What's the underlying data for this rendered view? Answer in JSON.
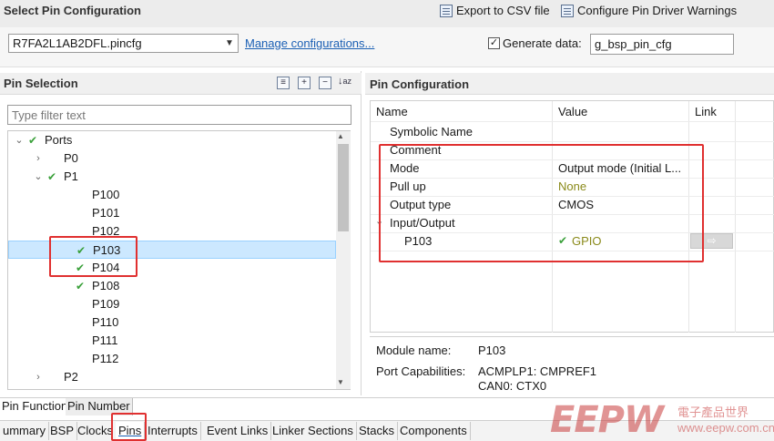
{
  "header": {
    "title": "Select Pin Configuration",
    "export_label": "Export to CSV file",
    "configure_label": "Configure Pin Driver Warnings"
  },
  "config": {
    "file": "R7FA2L1AB2DFL.pincfg",
    "manage_link": "Manage configurations...",
    "generate_checked": true,
    "generate_label": "Generate data:",
    "generate_value": "g_bsp_pin_cfg"
  },
  "pin_selection": {
    "title": "Pin Selection",
    "filter_placeholder": "Type filter text",
    "tree": [
      {
        "label": "Ports",
        "checked": true,
        "expanded": true,
        "level": 0
      },
      {
        "label": "P0",
        "checked": false,
        "expanded": false,
        "level": 1
      },
      {
        "label": "P1",
        "checked": true,
        "expanded": true,
        "level": 1
      },
      {
        "label": "P100",
        "checked": false,
        "level": 2
      },
      {
        "label": "P101",
        "checked": false,
        "level": 2
      },
      {
        "label": "P102",
        "checked": false,
        "level": 2
      },
      {
        "label": "P103",
        "checked": true,
        "level": 2,
        "selected": true
      },
      {
        "label": "P104",
        "checked": true,
        "level": 2
      },
      {
        "label": "P108",
        "checked": true,
        "level": 2
      },
      {
        "label": "P109",
        "checked": false,
        "level": 2
      },
      {
        "label": "P110",
        "checked": false,
        "level": 2
      },
      {
        "label": "P111",
        "checked": false,
        "level": 2
      },
      {
        "label": "P112",
        "checked": false,
        "level": 2
      },
      {
        "label": "P2",
        "checked": false,
        "expanded": false,
        "level": 1
      }
    ]
  },
  "pin_config": {
    "title": "Pin Configuration",
    "columns": [
      "Name",
      "Value",
      "Link"
    ],
    "rows": [
      {
        "name": "Symbolic Name",
        "value": ""
      },
      {
        "name": "Comment",
        "value": ""
      },
      {
        "name": "Mode",
        "value": "Output mode (Initial L..."
      },
      {
        "name": "Pull up",
        "value": "None"
      },
      {
        "name": "Output type",
        "value": "CMOS"
      },
      {
        "name": "Input/Output",
        "value": ""
      },
      {
        "name": "P103",
        "value": "GPIO"
      }
    ],
    "link_arrow": "⇨"
  },
  "module": {
    "name_label": "Module name:",
    "name_value": "P103",
    "caps_label": "Port Capabilities:",
    "caps_values": [
      "ACMPLP1: CMPREF1",
      "CAN0: CTX0"
    ]
  },
  "subtabs": [
    "Pin Function",
    "Pin Number"
  ],
  "bottom_tabs": [
    "ummary",
    "BSP",
    "Clocks",
    "Pins",
    "Interrupts",
    "Event Links",
    "Linker Sections",
    "Stacks",
    "Components"
  ],
  "watermark": {
    "logo": "EEPW",
    "cn": "電子產品世界",
    "url": "www.eepw.com.cn"
  },
  "colors": {
    "accent_red": "#e03030",
    "check_green": "#3aa03a",
    "link_blue": "#1a5fb4",
    "selection": "#cce8ff"
  }
}
